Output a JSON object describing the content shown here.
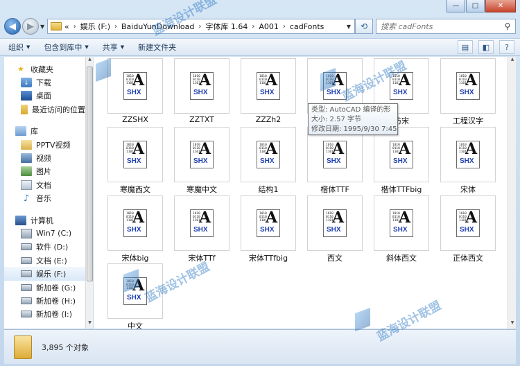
{
  "window": {
    "caption_minimize": "—",
    "caption_maximize": "□",
    "caption_close": "✕"
  },
  "breadcrumb": [
    "«",
    "娱乐 (F:)",
    "BaiduYunDownload",
    "字体库 1.64",
    "A001",
    "cadFonts"
  ],
  "search": {
    "placeholder": "搜索 cadFonts"
  },
  "toolbar": {
    "organize": "组织",
    "include": "包含到库中",
    "share": "共享",
    "new_folder": "新建文件夹"
  },
  "sidebar": {
    "favorites": {
      "label": "收藏夹",
      "items": [
        "下载",
        "桌面",
        "最近访问的位置"
      ]
    },
    "libraries": {
      "label": "库",
      "items": [
        "PPTV视频",
        "视频",
        "图片",
        "文档",
        "音乐"
      ]
    },
    "computer": {
      "label": "计算机",
      "items": [
        "Win7 (C:)",
        "软件 (D:)",
        "文档 (E:)",
        "娱乐 (F:)",
        "新加卷 (G:)",
        "新加卷 (H:)",
        "新加卷 (I:)"
      ]
    }
  },
  "file_icon": {
    "binary": "1010\n0110\n1101",
    "letter": "A",
    "tag": "SHX"
  },
  "files": [
    "ZZSHX",
    "ZZTXT",
    "ZZZh2",
    "",
    "",
    "工程汉字",
    "寒魔西文",
    "寒魔中文",
    "结构1",
    "楷体TTF",
    "楷体TTFbig",
    "宋体",
    "宋体big",
    "宋体TTf",
    "宋体TTfbig",
    "西文",
    "斜体西文",
    "正体西文",
    "中文"
  ],
  "partial_labels": {
    "file_5": "仿宋"
  },
  "tooltip": {
    "type": "类型: AutoCAD 编译的形",
    "size": "大小: 2.57 字节",
    "date": "修改日期: 1995/9/30 7:45"
  },
  "status": {
    "count": "3,895 个对象"
  },
  "watermark": {
    "text": "蓝海设计联盟"
  }
}
